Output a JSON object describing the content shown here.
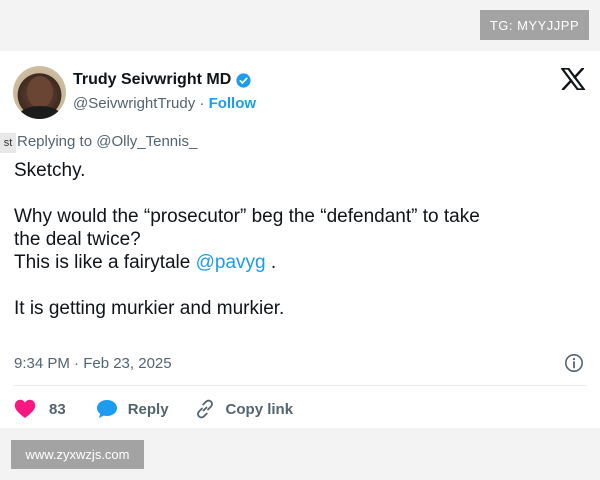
{
  "watermarks": {
    "top_right": "TG: MYYJJPP",
    "bottom_left": "www.zyxwzjs.com"
  },
  "tweet": {
    "author_name": "Trudy Seivwright MD",
    "handle": "@SeivwrightTrudy",
    "separator": "·",
    "follow_label": "Follow",
    "side_tab": "st",
    "replying_to": "Replying to @Olly_Tennis_",
    "lines": {
      "l1": "Sketchy.",
      "l2": "Why would the “prosecutor” beg the “defendant” to take",
      "l3": "the deal twice?",
      "l4_prefix": "This is like a fairytale ",
      "l4_mention": "@pavyg",
      "l4_suffix": " .",
      "l5": "It is getting murkier and murkier."
    },
    "timestamp": "9:34 PM · Feb 23, 2025"
  },
  "actions": {
    "like_count": "83",
    "reply_label": "Reply",
    "copy_label": "Copy link"
  },
  "icons": {
    "brand": "x-logo-icon",
    "verified": "verified-badge-icon",
    "info": "info-icon",
    "like": "heart-icon",
    "reply": "speech-bubble-icon",
    "copy": "link-icon"
  },
  "colors": {
    "accent": "#1d9bf0",
    "like": "#f91880",
    "secondary": "#536471"
  }
}
